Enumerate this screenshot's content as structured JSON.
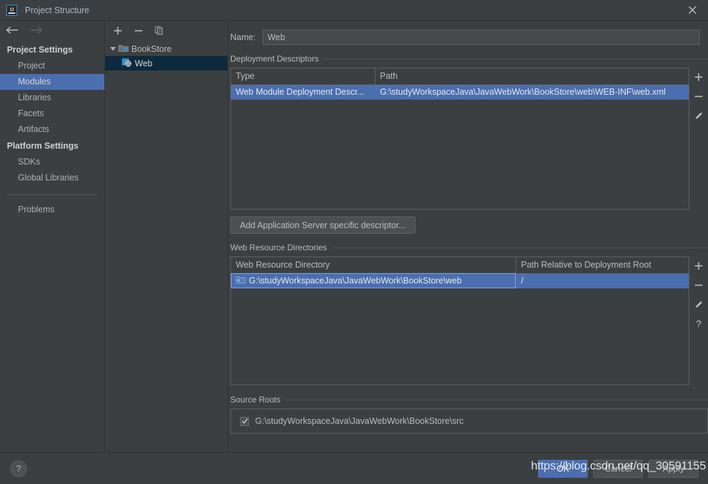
{
  "window": {
    "title": "Project Structure",
    "app_icon": "intellij-idea-icon",
    "close_label": "×"
  },
  "sidebar": {
    "nav": {
      "back": "back-arrow",
      "forward": "forward-arrow"
    },
    "groups": [
      {
        "title": "Project Settings",
        "items": [
          {
            "label": "Project",
            "selected": false
          },
          {
            "label": "Modules",
            "selected": true
          },
          {
            "label": "Libraries",
            "selected": false
          },
          {
            "label": "Facets",
            "selected": false
          },
          {
            "label": "Artifacts",
            "selected": false
          }
        ]
      },
      {
        "title": "Platform Settings",
        "items": [
          {
            "label": "SDKs",
            "selected": false
          },
          {
            "label": "Global Libraries",
            "selected": false
          }
        ]
      }
    ],
    "problems": {
      "label": "Problems"
    }
  },
  "tree": {
    "toolbar": [
      {
        "name": "add-module-button",
        "glyph": "+"
      },
      {
        "name": "remove-module-button",
        "glyph": "−"
      },
      {
        "name": "copy-module-button",
        "glyph": "copy-icon"
      }
    ],
    "nodes": [
      {
        "label": "BookStore",
        "icon": "module-folder-icon",
        "expanded": true,
        "depth": 0,
        "selected": false
      },
      {
        "label": "Web",
        "icon": "web-facet-icon",
        "depth": 1,
        "selected": true
      }
    ]
  },
  "main": {
    "name_field": {
      "label": "Name:",
      "value": "Web",
      "placeholder": ""
    },
    "deployment_descriptors": {
      "section_title": "Deployment Descriptors",
      "columns": [
        "Type",
        "Path"
      ],
      "rows": [
        {
          "type": "Web Module Deployment Descr...",
          "path": "G:\\studyWorkspaceJava\\JavaWebWork\\BookStore\\web\\WEB-INF\\web.xml",
          "selected": true
        }
      ],
      "actions": [
        {
          "name": "add-descriptor-button",
          "glyph": "+"
        },
        {
          "name": "remove-descriptor-button",
          "glyph": "−"
        },
        {
          "name": "edit-descriptor-button",
          "glyph": "pencil-icon"
        }
      ],
      "add_button_label": "Add Application Server specific descriptor..."
    },
    "web_resource_directories": {
      "section_title": "Web Resource Directories",
      "columns": [
        "Web Resource Directory",
        "Path Relative to Deployment Root"
      ],
      "rows": [
        {
          "directory": "G:\\studyWorkspaceJava\\JavaWebWork\\BookStore\\web",
          "relative_path": "/",
          "icon": "folder-icon",
          "selected": true
        }
      ],
      "actions": [
        {
          "name": "add-web-resource-button",
          "glyph": "+"
        },
        {
          "name": "remove-web-resource-button",
          "glyph": "−"
        },
        {
          "name": "edit-web-resource-button",
          "glyph": "pencil-icon"
        },
        {
          "name": "help-web-resource-button",
          "glyph": "?"
        }
      ]
    },
    "source_roots": {
      "section_title": "Source Roots",
      "entries": [
        {
          "path": "G:\\studyWorkspaceJava\\JavaWebWork\\BookStore\\src",
          "checked": true
        }
      ]
    }
  },
  "footer": {
    "help_button": "?",
    "buttons": [
      {
        "label": "OK",
        "primary": true,
        "name": "ok-button"
      },
      {
        "label": "Cancel",
        "primary": false,
        "name": "cancel-button"
      },
      {
        "label": "Apply",
        "primary": false,
        "name": "apply-button"
      }
    ]
  },
  "watermark": {
    "text": "https://blog.csdn.net/qq_30591155"
  },
  "colors": {
    "background": "#3c3f41",
    "selection_blue": "#4b6eaf",
    "inactive_selection": "#0d293e",
    "text": "#bbbbbb",
    "border": "#5e6060",
    "accent_icon": "#3592c4"
  }
}
